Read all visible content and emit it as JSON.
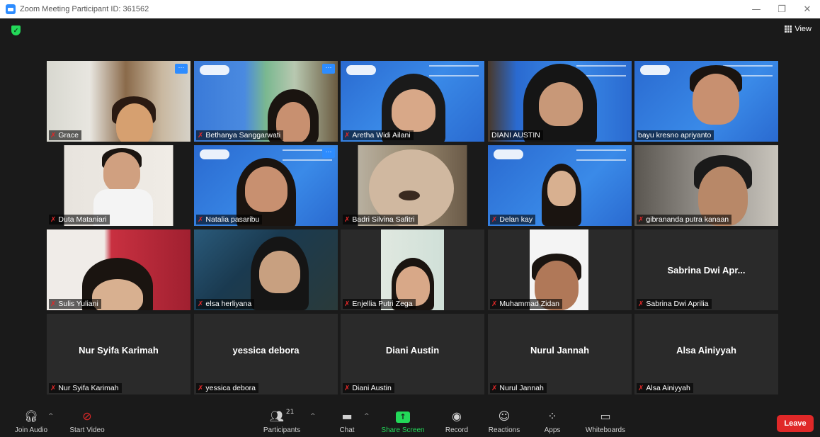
{
  "window": {
    "title": "Zoom Meeting Participant ID: 361562"
  },
  "header": {
    "view_label": "View"
  },
  "participants": [
    {
      "name": "Grace",
      "muted": true,
      "video": true
    },
    {
      "name": "Bethanya Sanggarwati",
      "muted": true,
      "video": true
    },
    {
      "name": "Aretha Widi Ailani",
      "muted": true,
      "video": true
    },
    {
      "name": "DIANI AUSTIN",
      "muted": false,
      "video": true
    },
    {
      "name": "bayu kresno apriyanto",
      "muted": false,
      "video": true,
      "active_speaker": true
    },
    {
      "name": "Duta Mataniari",
      "muted": true,
      "video": true
    },
    {
      "name": "Natalia pasaribu",
      "muted": true,
      "video": true
    },
    {
      "name": "Badri Silvina Safitri",
      "muted": true,
      "video": true
    },
    {
      "name": "Delan kay",
      "muted": true,
      "video": true
    },
    {
      "name": "gibrananda putra kanaan",
      "muted": true,
      "video": true
    },
    {
      "name": "Sulis Yuliani",
      "muted": true,
      "video": true
    },
    {
      "name": "elsa herliyana",
      "muted": true,
      "video": true
    },
    {
      "name": "Enjellia Putri Zega",
      "muted": true,
      "video": true
    },
    {
      "name": "Muhammad Zidan",
      "muted": true,
      "video": true
    },
    {
      "name": "Sabrina Dwi Aprilia",
      "display_name": "Sabrina Dwi Apr...",
      "muted": true,
      "video": false
    },
    {
      "name": "Nur Syifa Karimah",
      "display_name": "Nur Syifa Karimah",
      "muted": true,
      "video": false
    },
    {
      "name": "yessica debora",
      "display_name": "yessica debora",
      "muted": true,
      "video": false
    },
    {
      "name": "Diani Austin",
      "display_name": "Diani Austin",
      "muted": true,
      "video": false
    },
    {
      "name": "Nurul Jannah",
      "display_name": "Nurul Jannah",
      "muted": true,
      "video": false
    },
    {
      "name": "Alsa Ainiyyah",
      "display_name": "Alsa Ainiyyah",
      "muted": true,
      "video": false
    }
  ],
  "toolbar": {
    "join_audio": "Join Audio",
    "start_video": "Start Video",
    "participants": "Participants",
    "participants_count": "21",
    "chat": "Chat",
    "share_screen": "Share Screen",
    "record": "Record",
    "reactions": "Reactions",
    "apps": "Apps",
    "whiteboards": "Whiteboards",
    "leave": "Leave"
  },
  "colors": {
    "accent": "#2d8cff",
    "share": "#23d959",
    "leave": "#e02828",
    "active_speaker": "#e8e86a"
  },
  "icons": [
    "zoom-app-icon",
    "shield-icon",
    "grid-view-icon",
    "mic-muted-icon",
    "headphones-icon",
    "video-off-icon",
    "participants-icon",
    "chat-icon",
    "share-screen-icon",
    "record-icon",
    "reactions-icon",
    "apps-icon",
    "whiteboard-icon"
  ]
}
